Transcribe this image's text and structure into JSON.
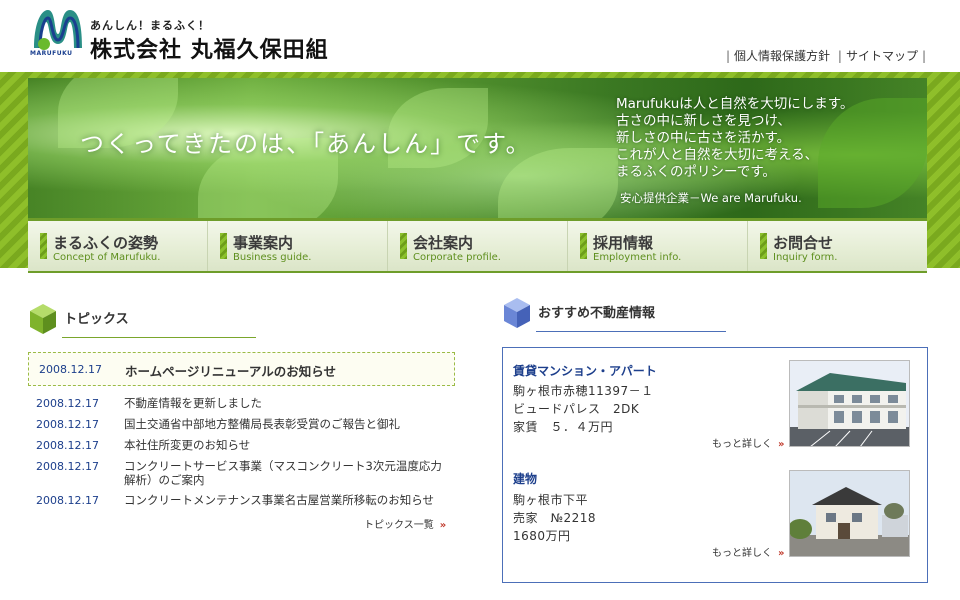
{
  "header": {
    "logo_tagline": "あんしん！まるふく！",
    "logo_name": "株式会社 丸福久保田組",
    "logo_small": "MARUFUKU",
    "links": [
      "個人情報保護方針",
      "サイトマップ"
    ]
  },
  "hero": {
    "catch": "つくってきたのは、「あんしん」です。",
    "copy_lines": [
      "Marufukuは人と自然を大切にします。",
      "古さの中に新しさを見つけ、",
      "新しさの中に古さを活かす。",
      "これが人と自然を大切に考える、",
      "まるふくのポリシーです。"
    ],
    "sub": "安心提供企業－We are Marufuku."
  },
  "nav": [
    {
      "jp": "まるふくの姿勢",
      "en": "Concept of Marufuku."
    },
    {
      "jp": "事業案内",
      "en": "Business guide."
    },
    {
      "jp": "会社案内",
      "en": "Corporate profile."
    },
    {
      "jp": "採用情報",
      "en": "Employment info."
    },
    {
      "jp": "お問合せ",
      "en": "Inquiry form."
    }
  ],
  "topics": {
    "heading": "トピックス",
    "featured": {
      "date": "2008.12.17",
      "title": "ホームページリニューアルのお知らせ"
    },
    "items": [
      {
        "date": "2008.12.17",
        "title": "不動産情報を更新しました"
      },
      {
        "date": "2008.12.17",
        "title": "国土交通省中部地方整備局長表彰受賞のご報告と御礼"
      },
      {
        "date": "2008.12.17",
        "title": "本社住所変更のお知らせ"
      },
      {
        "date": "2008.12.17",
        "title": "コンクリートサービス事業（マスコンクリート3次元温度応力解析）のご案内"
      },
      {
        "date": "2008.12.17",
        "title": "コンクリートメンテナンス事業名古屋営業所移転のお知らせ"
      }
    ],
    "more": "トピックス一覧"
  },
  "realestate": {
    "heading": "おすすめ不動産情報",
    "listings": [
      {
        "category": "賃貸マンション・アパート",
        "lines": [
          "駒ヶ根市赤穂11397－１",
          "ビュードパレス　2DK",
          "家賃　５．４万円"
        ],
        "more": "もっと詳しく"
      },
      {
        "category": "建物",
        "lines": [
          "駒ヶ根市下平",
          "売家　№2218",
          "1680万円"
        ],
        "more": "もっと詳しく"
      }
    ]
  },
  "colors": {
    "green": "#6e9d2a",
    "navy": "#1d3f8c",
    "frame_blue": "#4c6fb8"
  }
}
